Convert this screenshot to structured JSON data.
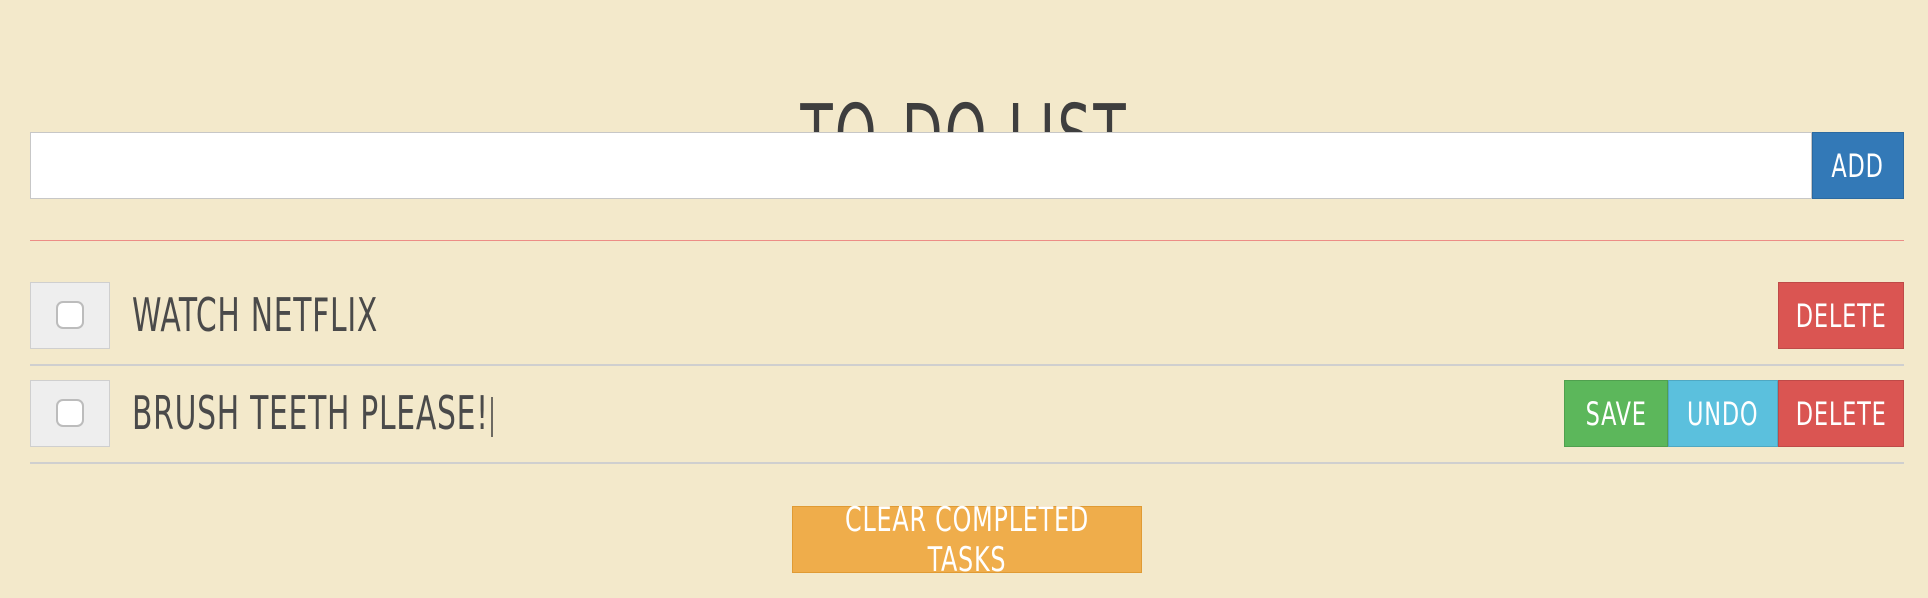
{
  "app": {
    "title": "TO-DO LIST"
  },
  "new_task": {
    "value": "",
    "placeholder": "",
    "add_label": "ADD"
  },
  "tasks": [
    {
      "text": "WATCH NETFLIX",
      "completed": false,
      "editing": false,
      "delete_label": "DELETE"
    },
    {
      "text": "BRUSH TEETH PLEASE!",
      "completed": false,
      "editing": true,
      "save_label": "SAVE",
      "undo_label": "UNDO",
      "delete_label": "DELETE"
    }
  ],
  "footer": {
    "clear_label": "CLEAR COMPLETED TASKS"
  },
  "colors": {
    "background": "#f3e9cb",
    "add": "#3379b7",
    "save": "#5cb75b",
    "undo": "#5bc0dd",
    "delete": "#da5552",
    "clear": "#efad4b",
    "divider": "#ec8d86"
  }
}
